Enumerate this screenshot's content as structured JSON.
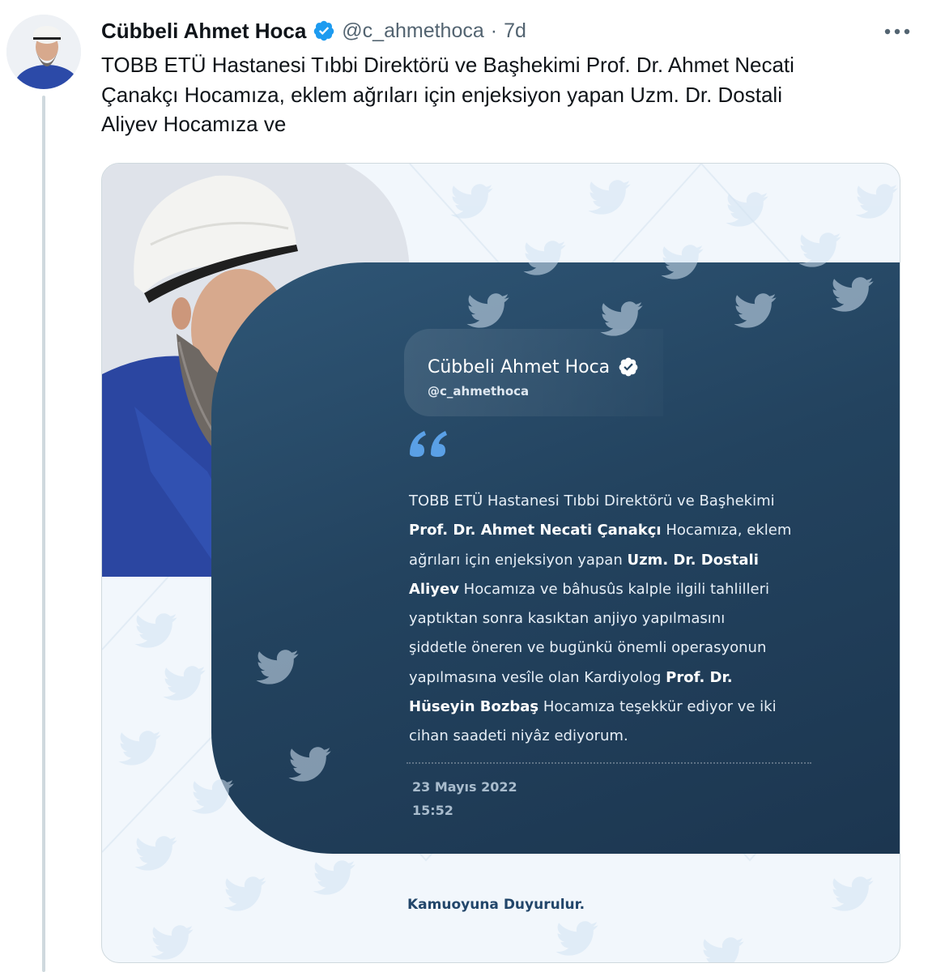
{
  "tweet": {
    "author": {
      "display_name": "Cübbeli Ahmet Hoca",
      "handle": "@c_ahmethoca",
      "verified": true
    },
    "separator": "·",
    "timestamp": "7d",
    "more_icon": "ellipsis-icon",
    "text_lines": [
      "TOBB ETÜ Hastanesi Tıbbi Direktörü ve Başhekimi Prof. Dr. Ahmet Necati",
      "Çanakçı Hocamıza, eklem ağrıları için enjeksiyon yapan Uzm. Dr. Dostali",
      "Aliyev Hocamıza ve"
    ]
  },
  "media": {
    "card_name": "Cübbeli Ahmet Hoca",
    "card_handle": "@c_ahmethoca",
    "quote_icon": "quote-mark-icon",
    "body_lines": [
      [
        {
          "t": "TOBB ETÜ Hastanesi Tıbbi Direktörü ve Başhekimi",
          "b": false
        }
      ],
      [
        {
          "t": "Prof. Dr. Ahmet Necati Çanakçı",
          "b": true
        },
        {
          "t": " Hocamıza, eklem",
          "b": false
        }
      ],
      [
        {
          "t": "ağrıları için enjeksiyon yapan ",
          "b": false
        },
        {
          "t": "Uzm. Dr. Dostali",
          "b": true
        }
      ],
      [
        {
          "t": "Aliyev",
          "b": true
        },
        {
          "t": " Hocamıza ve bâhusûs kalple ilgili tahlilleri",
          "b": false
        }
      ],
      [
        {
          "t": "yaptıktan sonra kasıktan anjiyo yapılmasını",
          "b": false
        }
      ],
      [
        {
          "t": "şiddetle öneren ve bugünkü önemli operasyonun",
          "b": false
        }
      ],
      [
        {
          "t": "yapılmasına vesîle olan Kardiyolog ",
          "b": false
        },
        {
          "t": "Prof. Dr.",
          "b": true
        }
      ],
      [
        {
          "t": "Hüseyin Bozbaş",
          "b": true
        },
        {
          "t": " Hocamıza teşekkür ediyor ve iki",
          "b": false
        }
      ],
      [
        {
          "t": "cihan saadeti niyâz ediyorum.",
          "b": false
        }
      ]
    ],
    "date": "23 Mayıs 2022",
    "time": "15:52",
    "footer": "Kamuoyuna Duyurulur.",
    "colors": {
      "panel": "#23435f",
      "accent_quote": "#5aa0e6",
      "twitter_blue": "#1d9bf0",
      "watermark_bird": "#d3e4f3"
    }
  }
}
